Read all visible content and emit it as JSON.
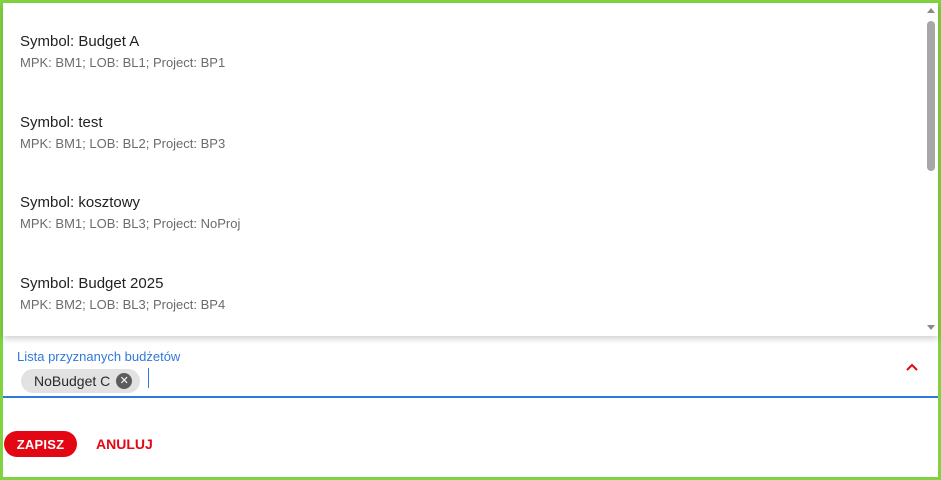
{
  "dropdown": {
    "options": [
      {
        "title": "Symbol: Budget A",
        "subtitle": "MPK: BM1; LOB: BL1; Project: BP1"
      },
      {
        "title": "Symbol: test",
        "subtitle": "MPK: BM1; LOB: BL2; Project: BP3"
      },
      {
        "title": "Symbol: kosztowy",
        "subtitle": "MPK: BM1; LOB: BL3; Project: NoProj"
      },
      {
        "title": "Symbol: Budget 2025",
        "subtitle": "MPK: BM2; LOB: BL3; Project: BP4"
      }
    ]
  },
  "field": {
    "label": "Lista przyznanych budżetów",
    "selected_chip": "NoBudget C",
    "remove_icon": "close-circle-icon",
    "toggle_icon": "chevron-up-icon"
  },
  "actions": {
    "save_label": "ZAPISZ",
    "cancel_label": "ANULUJ"
  },
  "colors": {
    "frame": "#7fd33f",
    "accent_blue": "#2f7ad8",
    "primary_red": "#e30613"
  }
}
